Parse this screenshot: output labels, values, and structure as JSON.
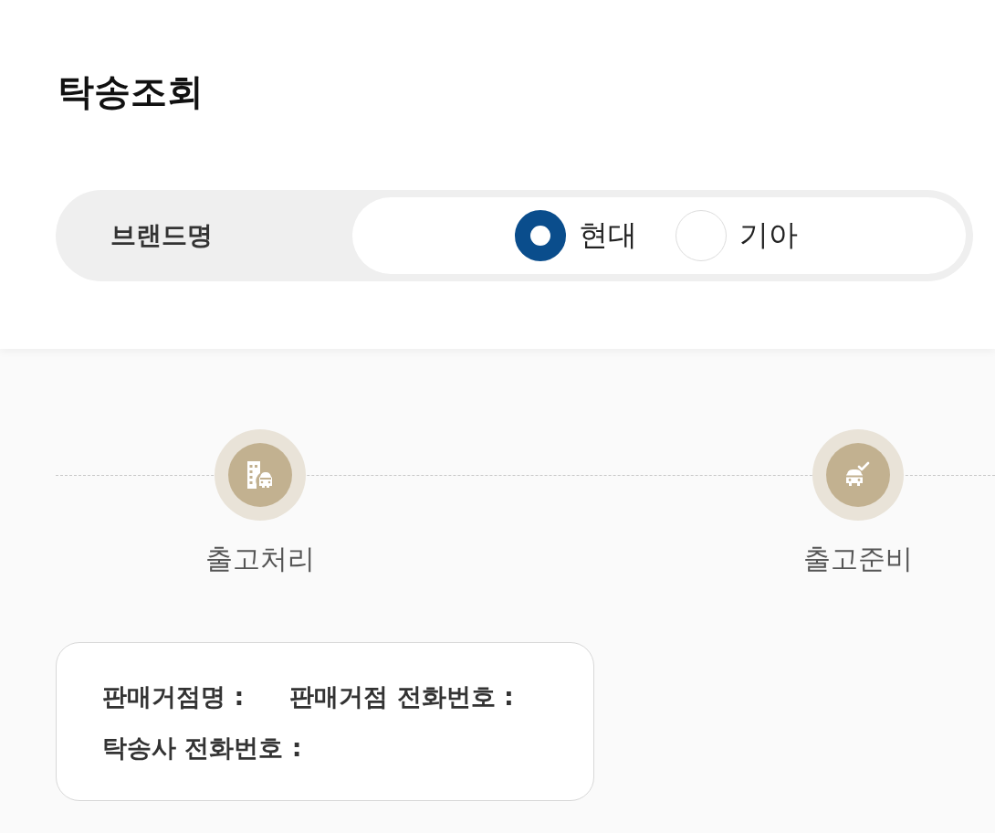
{
  "title": "탁송조회",
  "brand_filter": {
    "label": "브랜드명",
    "options": [
      {
        "label": "현대",
        "selected": true
      },
      {
        "label": "기아",
        "selected": false
      }
    ]
  },
  "steps": [
    {
      "kind": "building-car",
      "label": "출고처리"
    },
    {
      "kind": "car-check",
      "label": "출고준비"
    }
  ],
  "info_card": {
    "fields": [
      {
        "label": "판매거점명 :"
      },
      {
        "label": "판매거점 전화번호 :"
      },
      {
        "label": "탁송사 전화번호 :"
      }
    ]
  }
}
